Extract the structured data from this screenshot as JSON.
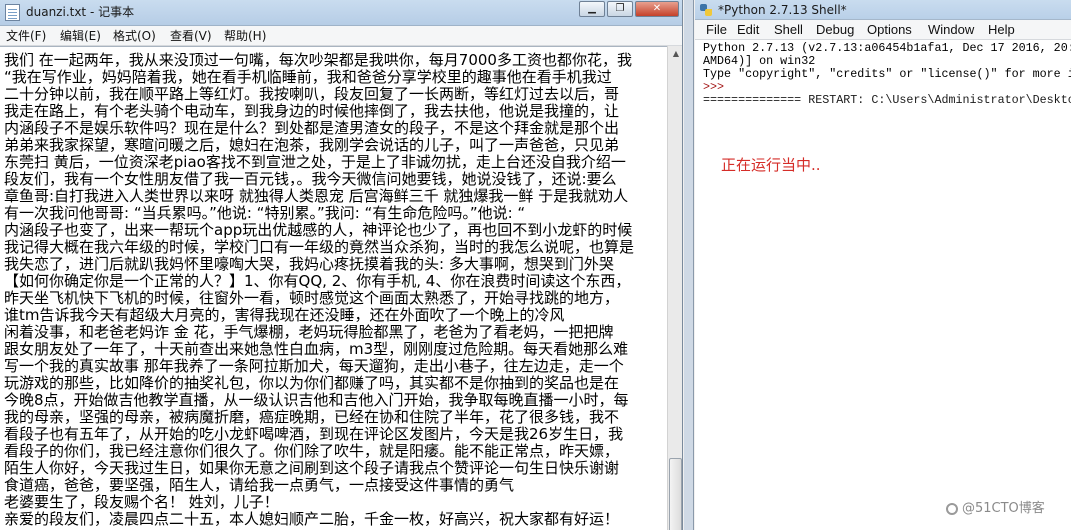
{
  "notepad": {
    "title": "duanzi.txt - 记事本",
    "menu": [
      "文件(F)",
      "编辑(E)",
      "格式(O)",
      "查看(V)",
      "帮助(H)"
    ],
    "window_buttons": [
      "▁",
      "❐",
      "✕"
    ],
    "lines": [
      "我们 在一起两年，我从来没顶过一句嘴，每次吵架都是我哄你，每月7000多工资也都你花，我",
      "“我在写作业，妈妈陪着我，她在看手机临睡前，我和爸爸分享学校里的趣事他在看手机我过",
      "二十分钟以前，我在顺平路上等红灯。我按喇叭，段友回复了一长两断，等红灯过去以后，哥",
      "我走在路上，有个老头骑个电动车，到我身边的时候他摔倒了，我去扶他，他说是我撞的，让",
      "内涵段子不是娱乐软件吗？现在是什么？到处都是渣男渣女的段子，不是这个拜金就是那个出",
      "弟弟来我家探望，寒暄问暖之后，媳妇在泡茶，我刚学会说话的儿子，叫了一声爸爸，只见弟",
      "东莞扫 黄后，一位资深老piao客找不到宣泄之处，于是上了非诚勿扰，走上台还没自我介绍一",
      "段友们，我有一个女性朋友借了我一百元钱，。我今天微信问她要钱，她说没钱了，还说:要么",
      "章鱼哥:自打我进入人类世界以来呀 就独得人类恩宠 后宫海鲜三千 就独爆我一鲜 于是我就劝人",
      "有一次我问他哥哥: “当兵累吗。”他说: “特别累。”我问: “有生命危险吗。”他说: “",
      "内涵段子也变了，出来一帮玩个app玩出优越感的人，神评论也少了，再也回不到小龙虾的时候",
      "我记得大概在我六年级的时候，学校门口有一年级的竟然当众杀狗，当时的我怎么说呢，也算是",
      "我失恋了，进门后就趴我妈怀里嚎啕大哭，我妈心疼抚摸着我的头: 多大事啊，想哭到门外哭",
      "【如何你确定你是一个正常的人？】1、你有QQ, 2、你有手机, 4、你在浪费时间读这个东西，",
      "昨天坐飞机快下飞机的时候，往窗外一看，顿时感觉这个画面太熟悉了，开始寻找跳的地方，",
      "谁tm告诉我今天有超级大月亮的，害得我现在还没睡，还在外面吹了一个晚上的冷风",
      "闲着没事，和老爸老妈诈 金 花，手气爆棚，老妈玩得脸都黑了，老爸为了看老妈，一把把牌",
      "跟女朋友处了一年了，十天前查出来她急性白血病，m3型，刚刚度过危险期。每天看她那么难",
      "写一个我的真实故事 那年我养了一条阿拉斯加犬，每天遛狗，走出小巷子，往左边走，走一个",
      "玩游戏的那些，比如降价的抽奖礼包，你以为你们都赚了吗，其实都不是你抽到的奖品也是在",
      "今晚8点，开始做吉他教学直播，从一级认识吉他和吉他入门开始，我争取每晚直播一小时，每",
      "我的母亲，坚强的母亲，被病魔折磨，癌症晚期，已经在协和住院了半年，花了很多钱，我不",
      "看段子也有五年了，从开始的吃小龙虾喝啤酒，到现在评论区发图片，今天是我26岁生日，我",
      "看段子的你们，我已经注意你们很久了。你们除了吹牛，就是阳痿。能不能正常点，昨天嫖，",
      "陌生人你好，今天我过生日，如果你无意之间刷到这个段子请我点个赞评论一句生日快乐谢谢",
      "食道癌，爸爸，要坚强，陌生人，请给我一点勇气，一点接受这件事情的勇气",
      "老婆要生了，段友赐个名！ 姓刘，儿子！",
      "亲爱的段友们，凌晨四点二十五，本人媳妇顺产二胎，千金一枚，好高兴，祝大家都有好运！"
    ]
  },
  "shell": {
    "title": "*Python 2.7.13 Shell*",
    "menu": [
      "File",
      "Edit",
      "Shell",
      "Debug",
      "Options",
      "Window",
      "Help"
    ],
    "lines": [
      "Python 2.7.13 (v2.7.13:a06454b1afa1, Dec 17 2016, 20:",
      "AMD64)] on win32",
      "Type \"copyright\", \"credits\" or \"license()\" for more i",
      ">>>",
      "============== RESTART: C:\\Users\\Administrator\\Deskto"
    ],
    "status": "正在运行当中.."
  },
  "watermark": "@51CTO博客"
}
